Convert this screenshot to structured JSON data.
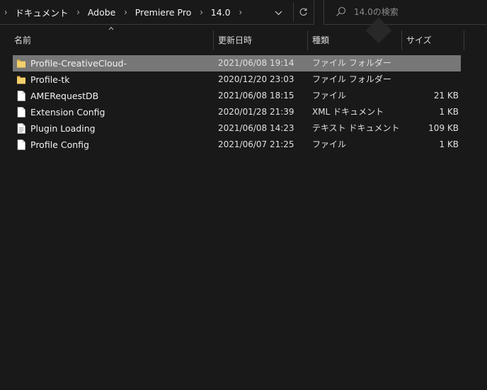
{
  "breadcrumb": [
    {
      "label": "ドキュメント"
    },
    {
      "label": "Adobe"
    },
    {
      "label": "Premiere Pro"
    },
    {
      "label": "14.0"
    }
  ],
  "search": {
    "placeholder": "14.0の検索"
  },
  "columns": {
    "name": "名前",
    "date": "更新日時",
    "type": "種類",
    "size": "サイズ"
  },
  "files": [
    {
      "name": "Profile-CreativeCloud-",
      "date": "2021/06/08 19:14",
      "type": "ファイル フォルダー",
      "size": "",
      "icon": "folder-icon",
      "selected": true
    },
    {
      "name": "Profile-tk",
      "date": "2020/12/20 23:03",
      "type": "ファイル フォルダー",
      "size": "",
      "icon": "folder-icon",
      "selected": false
    },
    {
      "name": "AMERequestDB",
      "date": "2021/06/08 18:15",
      "type": "ファイル",
      "size": "21 KB",
      "icon": "file-icon",
      "selected": false
    },
    {
      "name": "Extension Config",
      "date": "2020/01/28 21:39",
      "type": "XML ドキュメント",
      "size": "1 KB",
      "icon": "file-icon",
      "selected": false
    },
    {
      "name": "Plugin Loading",
      "date": "2021/06/08 14:23",
      "type": "テキスト ドキュメント",
      "size": "109 KB",
      "icon": "text-file-icon",
      "selected": false
    },
    {
      "name": "Profile Config",
      "date": "2021/06/07 21:25",
      "type": "ファイル",
      "size": "1 KB",
      "icon": "file-icon",
      "selected": false
    }
  ],
  "colors": {
    "background": "#191919",
    "selected_row": "#777777",
    "folder": "#e8b84a"
  }
}
